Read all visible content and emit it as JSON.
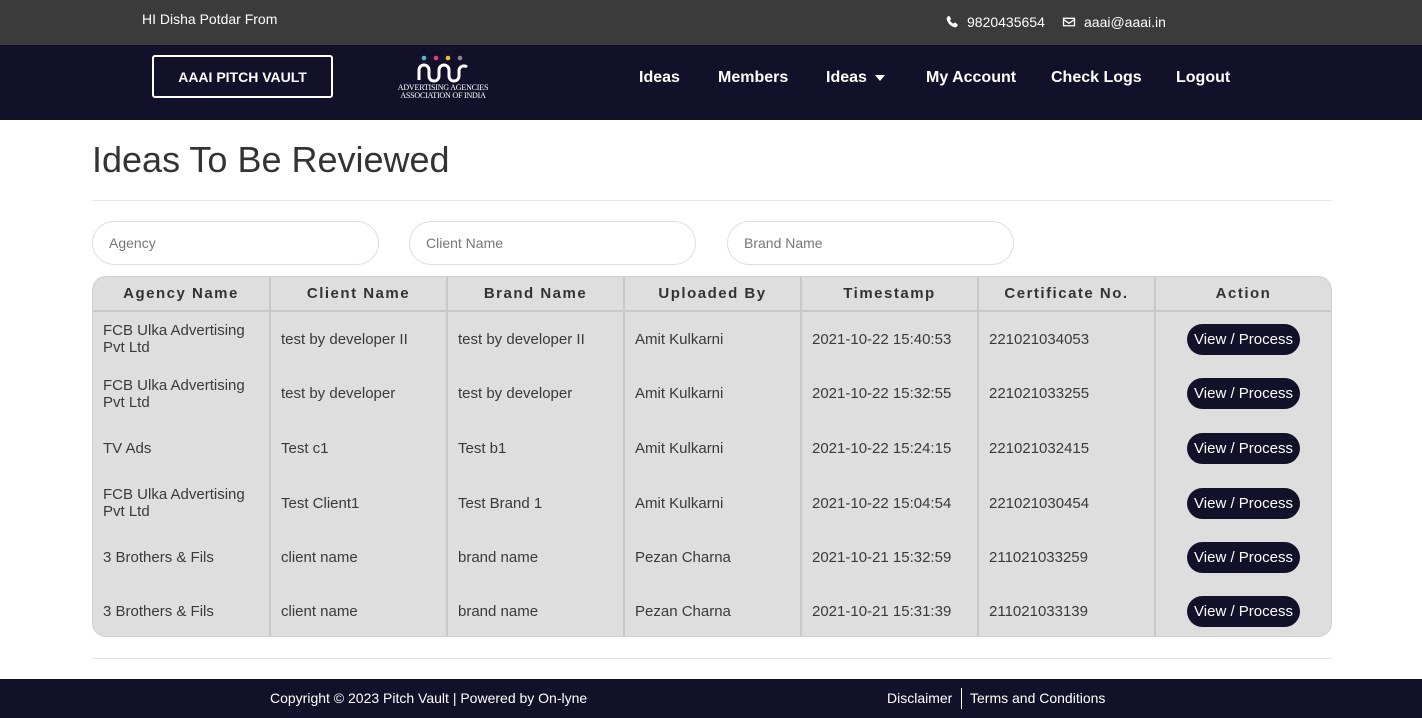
{
  "topbar": {
    "greeting": "HI Disha Potdar From",
    "phone": "9820435654",
    "email": "aaai@aaai.in",
    "phone_icon": "phone-icon",
    "email_icon": "envelope-icon"
  },
  "nav": {
    "brand_button": "AAAI PITCH VAULT",
    "logo_line1": "ADVERTISING AGENCIES",
    "logo_line2": "ASSOCIATION OF INDIA",
    "items": [
      {
        "label": "Ideas"
      },
      {
        "label": "Members"
      },
      {
        "label": "Ideas",
        "dropdown": true
      },
      {
        "label": "My Account"
      },
      {
        "label": "Check Logs"
      },
      {
        "label": "Logout"
      }
    ]
  },
  "page": {
    "title": "Ideas To Be Reviewed"
  },
  "filters": {
    "agency_placeholder": "Agency",
    "client_placeholder": "Client Name",
    "brand_placeholder": "Brand Name"
  },
  "table": {
    "headers": [
      "Agency Name",
      "Client Name",
      "Brand Name",
      "Uploaded By",
      "Timestamp",
      "Certificate No.",
      "Action"
    ],
    "action_label": "View / Process",
    "rows": [
      {
        "agency": "FCB Ulka Advertising Pvt Ltd",
        "client": "test by developer II",
        "brand": "test by developer II",
        "uploaded_by": "Amit Kulkarni",
        "timestamp": "2021-10-22 15:40:53",
        "certificate": "221021034053"
      },
      {
        "agency": "FCB Ulka Advertising Pvt Ltd",
        "client": "test by developer",
        "brand": "test by developer",
        "uploaded_by": "Amit Kulkarni",
        "timestamp": "2021-10-22 15:32:55",
        "certificate": "221021033255"
      },
      {
        "agency": "TV Ads",
        "client": "Test c1",
        "brand": "Test b1",
        "uploaded_by": "Amit Kulkarni",
        "timestamp": "2021-10-22 15:24:15",
        "certificate": "221021032415"
      },
      {
        "agency": "FCB Ulka Advertising Pvt Ltd",
        "client": "Test Client1",
        "brand": "Test Brand 1",
        "uploaded_by": "Amit Kulkarni",
        "timestamp": "2021-10-22 15:04:54",
        "certificate": "221021030454"
      },
      {
        "agency": "3 Brothers & Fils",
        "client": "client name",
        "brand": "brand name",
        "uploaded_by": "Pezan Charna",
        "timestamp": "2021-10-21 15:32:59",
        "certificate": "211021033259"
      },
      {
        "agency": "3 Brothers & Fils",
        "client": "client name",
        "brand": "brand name",
        "uploaded_by": "Pezan Charna",
        "timestamp": "2021-10-21 15:31:39",
        "certificate": "211021033139"
      }
    ]
  },
  "footer": {
    "copyright": "Copyright © 2023 Pitch Vault | Powered by On-lyne",
    "disclaimer": "Disclaimer",
    "terms": "Terms and Conditions"
  },
  "colors": {
    "topbar_bg": "#3b3b3b",
    "navbar_bg": "#13112a",
    "table_bg": "#dedede",
    "button_bg": "#13112a"
  }
}
